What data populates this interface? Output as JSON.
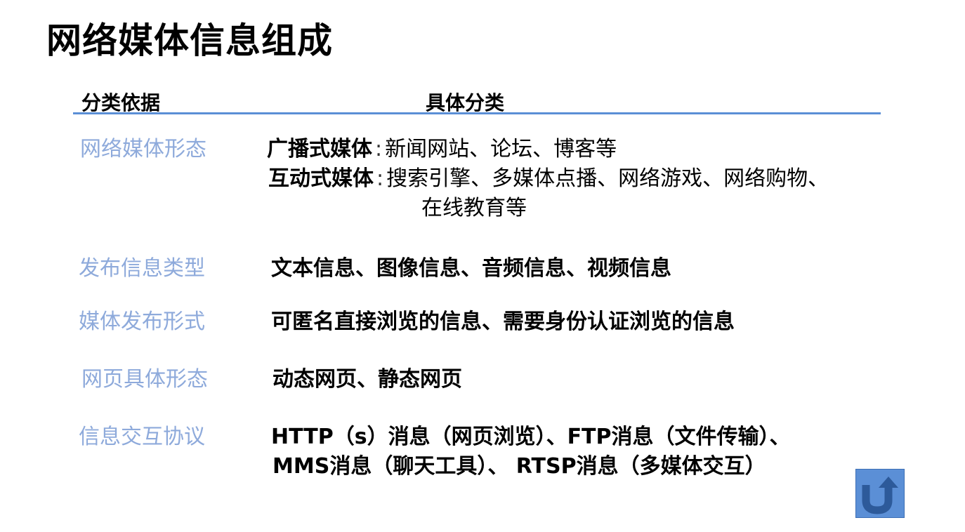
{
  "title": "网络媒体信息组成",
  "headers": {
    "basis": "分类依据",
    "detail": "具体分类"
  },
  "rows": [
    {
      "label": "网络媒体形态",
      "broadcast_kind": "广播式媒体",
      "broadcast_sep": ":",
      "broadcast_items": "新闻网站、论坛、博客等",
      "interactive_kind": "互动式媒体",
      "interactive_sep": ":",
      "interactive_items": "搜索引擎、多媒体点播、网络游戏、网络购物、",
      "interactive_items_cont": "在线教育等"
    },
    {
      "label": "发布信息类型",
      "value": "文本信息、图像信息、音频信息、视频信息"
    },
    {
      "label": "媒体发布形式",
      "value": "可匿名直接浏览的信息、需要身份认证浏览的信息"
    },
    {
      "label": "网页具体形态",
      "value": "动态网页、静态网页"
    },
    {
      "label": "信息交互协议",
      "value": "HTTP（s）消息（网页浏览）、FTP消息（文件传输）、",
      "value_cont": "MMS消息（聊天工具）、 RTSP消息（多媒体交互）"
    }
  ],
  "back_button": {
    "icon": "u-turn-up-arrow-icon",
    "color": "#5b8fd6"
  },
  "colors": {
    "label": "#8eaadb",
    "rule": "#5b8fd6"
  }
}
